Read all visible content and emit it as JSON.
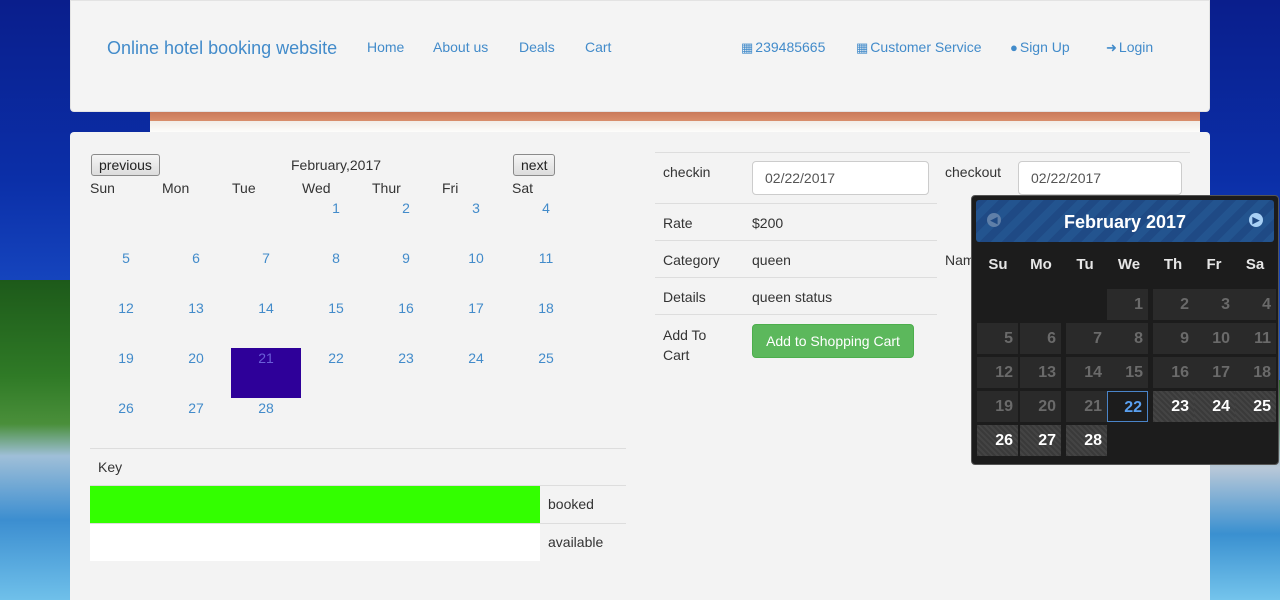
{
  "navbar": {
    "brand": "Online hotel booking website",
    "links": [
      "Home",
      "About us",
      "Deals",
      "Cart"
    ],
    "phone": "239485665",
    "customer_service": "Customer Service",
    "signup": "Sign Up",
    "login": "Login"
  },
  "calendar": {
    "prev_label": "previous",
    "next_label": "next",
    "title": "February,2017",
    "weekdays": [
      "Sun",
      "Mon",
      "Tue",
      "Wed",
      "Thur",
      "Fri",
      "Sat"
    ],
    "highlighted_day": "21"
  },
  "key": {
    "heading": "Key",
    "rows": [
      {
        "label": "booked",
        "color": "#33ff00"
      },
      {
        "label": "available",
        "color": "#ffffff"
      }
    ]
  },
  "details": {
    "checkin_label": "checkin",
    "checkin_value": "02/22/2017",
    "checkout_label": "checkout",
    "checkout_value": "02/22/2017",
    "rate_label": "Rate",
    "rate_value": "$200",
    "category_label": "Category",
    "category_value": "queen",
    "name_label_partial": "Nam",
    "details_label": "Details",
    "details_value": "queen status",
    "addtocart_label_line1": "Add To",
    "addtocart_label_line2": "Cart",
    "addtocart_button": "Add to Shopping Cart"
  },
  "datepicker": {
    "title": "February 2017",
    "weekdays": [
      "Su",
      "Mo",
      "Tu",
      "We",
      "Th",
      "Fr",
      "Sa"
    ],
    "selected_day": "22"
  },
  "colors": {
    "link": "#428bca",
    "highlight_day": "#2e0099",
    "cart_button": "#5cb85c"
  }
}
